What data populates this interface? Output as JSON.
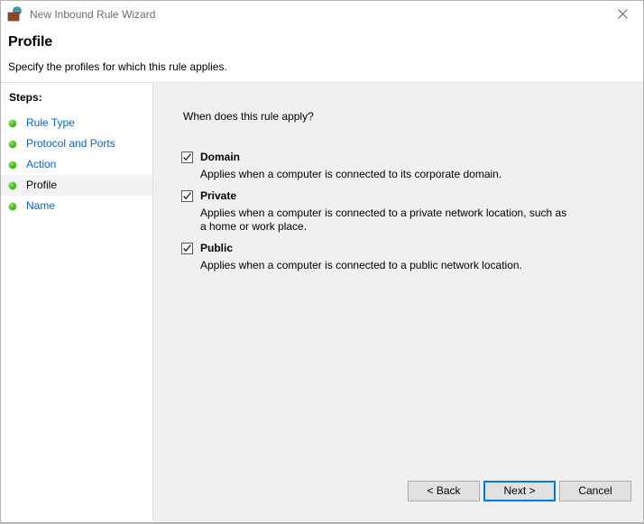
{
  "window": {
    "title": "New Inbound Rule Wizard",
    "icon": "firewall-globe-icon",
    "close_label": "✕"
  },
  "header": {
    "title": "Profile",
    "subtitle": "Specify the profiles for which this rule applies."
  },
  "sidebar": {
    "heading": "Steps:",
    "items": [
      {
        "label": "Rule Type",
        "current": false
      },
      {
        "label": "Protocol and Ports",
        "current": false
      },
      {
        "label": "Action",
        "current": false
      },
      {
        "label": "Profile",
        "current": true
      },
      {
        "label": "Name",
        "current": false
      }
    ]
  },
  "main": {
    "question": "When does this rule apply?",
    "options": [
      {
        "label": "Domain",
        "checked": true,
        "description": "Applies when a computer is connected to its corporate domain."
      },
      {
        "label": "Private",
        "checked": true,
        "description": "Applies when a computer is connected to a private network location, such as a home or work place."
      },
      {
        "label": "Public",
        "checked": true,
        "description": "Applies when a computer is connected to a public network location."
      }
    ]
  },
  "footer": {
    "back_label": "< Back",
    "next_label": "Next >",
    "cancel_label": "Cancel"
  },
  "colors": {
    "accent": "#0078d7",
    "link": "#1262b5",
    "pane_background": "#f0f0f0",
    "step_done": "#48c217"
  }
}
